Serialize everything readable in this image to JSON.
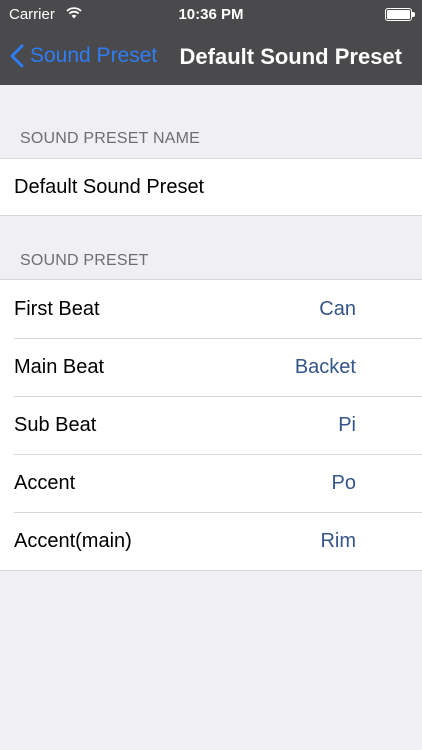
{
  "status_bar": {
    "carrier": "Carrier",
    "time": "10:36 PM",
    "wifi_icon": "wifi-icon",
    "battery_icon": "battery-icon"
  },
  "navbar": {
    "back_label": "Sound Preset",
    "title": "Default Sound Preset",
    "back_icon": "chevron-left-icon",
    "accent_color": "#2e7cf6",
    "bar_color": "#4a4a4c"
  },
  "name_section": {
    "header": "SOUND PRESET NAME",
    "name": "Default Sound Preset"
  },
  "preset_section": {
    "header": "SOUND PRESET",
    "value_color": "#335589",
    "rows": [
      {
        "label": "First Beat",
        "value": "Can"
      },
      {
        "label": "Main Beat",
        "value": "Backet"
      },
      {
        "label": "Sub Beat",
        "value": "Pi"
      },
      {
        "label": "Accent",
        "value": "Po"
      },
      {
        "label": "Accent(main)",
        "value": "Rim"
      }
    ]
  }
}
